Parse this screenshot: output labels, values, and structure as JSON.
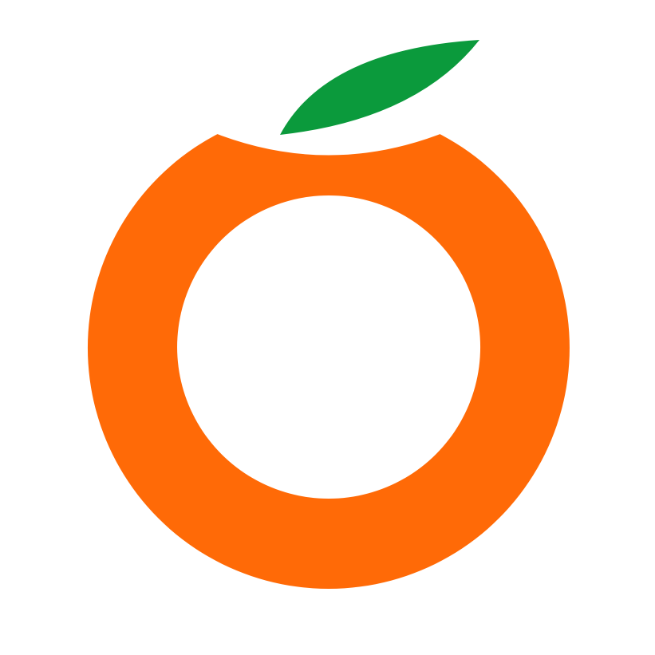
{
  "logo": {
    "name": "orange-fruit-logo",
    "colors": {
      "background": "#ffffff",
      "ring": "#ff6a07",
      "leaf": "#0b9a3c",
      "bite": "#ffffff"
    }
  }
}
